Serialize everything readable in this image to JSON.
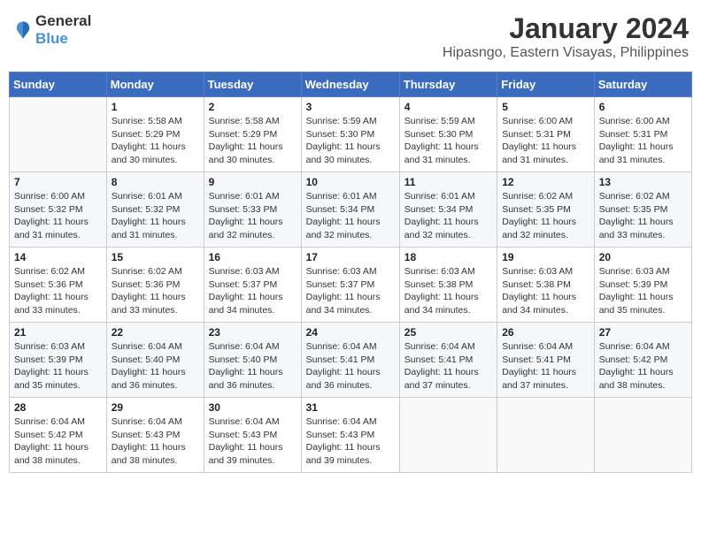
{
  "logo": {
    "text_general": "General",
    "text_blue": "Blue"
  },
  "header": {
    "month_title": "January 2024",
    "location": "Hipasngo, Eastern Visayas, Philippines"
  },
  "weekdays": [
    "Sunday",
    "Monday",
    "Tuesday",
    "Wednesday",
    "Thursday",
    "Friday",
    "Saturday"
  ],
  "weeks": [
    [
      {
        "day": "",
        "sunrise": "",
        "sunset": "",
        "daylight": ""
      },
      {
        "day": "1",
        "sunrise": "Sunrise: 5:58 AM",
        "sunset": "Sunset: 5:29 PM",
        "daylight": "Daylight: 11 hours and 30 minutes."
      },
      {
        "day": "2",
        "sunrise": "Sunrise: 5:58 AM",
        "sunset": "Sunset: 5:29 PM",
        "daylight": "Daylight: 11 hours and 30 minutes."
      },
      {
        "day": "3",
        "sunrise": "Sunrise: 5:59 AM",
        "sunset": "Sunset: 5:30 PM",
        "daylight": "Daylight: 11 hours and 30 minutes."
      },
      {
        "day": "4",
        "sunrise": "Sunrise: 5:59 AM",
        "sunset": "Sunset: 5:30 PM",
        "daylight": "Daylight: 11 hours and 31 minutes."
      },
      {
        "day": "5",
        "sunrise": "Sunrise: 6:00 AM",
        "sunset": "Sunset: 5:31 PM",
        "daylight": "Daylight: 11 hours and 31 minutes."
      },
      {
        "day": "6",
        "sunrise": "Sunrise: 6:00 AM",
        "sunset": "Sunset: 5:31 PM",
        "daylight": "Daylight: 11 hours and 31 minutes."
      }
    ],
    [
      {
        "day": "7",
        "sunrise": "Sunrise: 6:00 AM",
        "sunset": "Sunset: 5:32 PM",
        "daylight": "Daylight: 11 hours and 31 minutes."
      },
      {
        "day": "8",
        "sunrise": "Sunrise: 6:01 AM",
        "sunset": "Sunset: 5:32 PM",
        "daylight": "Daylight: 11 hours and 31 minutes."
      },
      {
        "day": "9",
        "sunrise": "Sunrise: 6:01 AM",
        "sunset": "Sunset: 5:33 PM",
        "daylight": "Daylight: 11 hours and 32 minutes."
      },
      {
        "day": "10",
        "sunrise": "Sunrise: 6:01 AM",
        "sunset": "Sunset: 5:34 PM",
        "daylight": "Daylight: 11 hours and 32 minutes."
      },
      {
        "day": "11",
        "sunrise": "Sunrise: 6:01 AM",
        "sunset": "Sunset: 5:34 PM",
        "daylight": "Daylight: 11 hours and 32 minutes."
      },
      {
        "day": "12",
        "sunrise": "Sunrise: 6:02 AM",
        "sunset": "Sunset: 5:35 PM",
        "daylight": "Daylight: 11 hours and 32 minutes."
      },
      {
        "day": "13",
        "sunrise": "Sunrise: 6:02 AM",
        "sunset": "Sunset: 5:35 PM",
        "daylight": "Daylight: 11 hours and 33 minutes."
      }
    ],
    [
      {
        "day": "14",
        "sunrise": "Sunrise: 6:02 AM",
        "sunset": "Sunset: 5:36 PM",
        "daylight": "Daylight: 11 hours and 33 minutes."
      },
      {
        "day": "15",
        "sunrise": "Sunrise: 6:02 AM",
        "sunset": "Sunset: 5:36 PM",
        "daylight": "Daylight: 11 hours and 33 minutes."
      },
      {
        "day": "16",
        "sunrise": "Sunrise: 6:03 AM",
        "sunset": "Sunset: 5:37 PM",
        "daylight": "Daylight: 11 hours and 34 minutes."
      },
      {
        "day": "17",
        "sunrise": "Sunrise: 6:03 AM",
        "sunset": "Sunset: 5:37 PM",
        "daylight": "Daylight: 11 hours and 34 minutes."
      },
      {
        "day": "18",
        "sunrise": "Sunrise: 6:03 AM",
        "sunset": "Sunset: 5:38 PM",
        "daylight": "Daylight: 11 hours and 34 minutes."
      },
      {
        "day": "19",
        "sunrise": "Sunrise: 6:03 AM",
        "sunset": "Sunset: 5:38 PM",
        "daylight": "Daylight: 11 hours and 34 minutes."
      },
      {
        "day": "20",
        "sunrise": "Sunrise: 6:03 AM",
        "sunset": "Sunset: 5:39 PM",
        "daylight": "Daylight: 11 hours and 35 minutes."
      }
    ],
    [
      {
        "day": "21",
        "sunrise": "Sunrise: 6:03 AM",
        "sunset": "Sunset: 5:39 PM",
        "daylight": "Daylight: 11 hours and 35 minutes."
      },
      {
        "day": "22",
        "sunrise": "Sunrise: 6:04 AM",
        "sunset": "Sunset: 5:40 PM",
        "daylight": "Daylight: 11 hours and 36 minutes."
      },
      {
        "day": "23",
        "sunrise": "Sunrise: 6:04 AM",
        "sunset": "Sunset: 5:40 PM",
        "daylight": "Daylight: 11 hours and 36 minutes."
      },
      {
        "day": "24",
        "sunrise": "Sunrise: 6:04 AM",
        "sunset": "Sunset: 5:41 PM",
        "daylight": "Daylight: 11 hours and 36 minutes."
      },
      {
        "day": "25",
        "sunrise": "Sunrise: 6:04 AM",
        "sunset": "Sunset: 5:41 PM",
        "daylight": "Daylight: 11 hours and 37 minutes."
      },
      {
        "day": "26",
        "sunrise": "Sunrise: 6:04 AM",
        "sunset": "Sunset: 5:41 PM",
        "daylight": "Daylight: 11 hours and 37 minutes."
      },
      {
        "day": "27",
        "sunrise": "Sunrise: 6:04 AM",
        "sunset": "Sunset: 5:42 PM",
        "daylight": "Daylight: 11 hours and 38 minutes."
      }
    ],
    [
      {
        "day": "28",
        "sunrise": "Sunrise: 6:04 AM",
        "sunset": "Sunset: 5:42 PM",
        "daylight": "Daylight: 11 hours and 38 minutes."
      },
      {
        "day": "29",
        "sunrise": "Sunrise: 6:04 AM",
        "sunset": "Sunset: 5:43 PM",
        "daylight": "Daylight: 11 hours and 38 minutes."
      },
      {
        "day": "30",
        "sunrise": "Sunrise: 6:04 AM",
        "sunset": "Sunset: 5:43 PM",
        "daylight": "Daylight: 11 hours and 39 minutes."
      },
      {
        "day": "31",
        "sunrise": "Sunrise: 6:04 AM",
        "sunset": "Sunset: 5:43 PM",
        "daylight": "Daylight: 11 hours and 39 minutes."
      },
      {
        "day": "",
        "sunrise": "",
        "sunset": "",
        "daylight": ""
      },
      {
        "day": "",
        "sunrise": "",
        "sunset": "",
        "daylight": ""
      },
      {
        "day": "",
        "sunrise": "",
        "sunset": "",
        "daylight": ""
      }
    ]
  ]
}
